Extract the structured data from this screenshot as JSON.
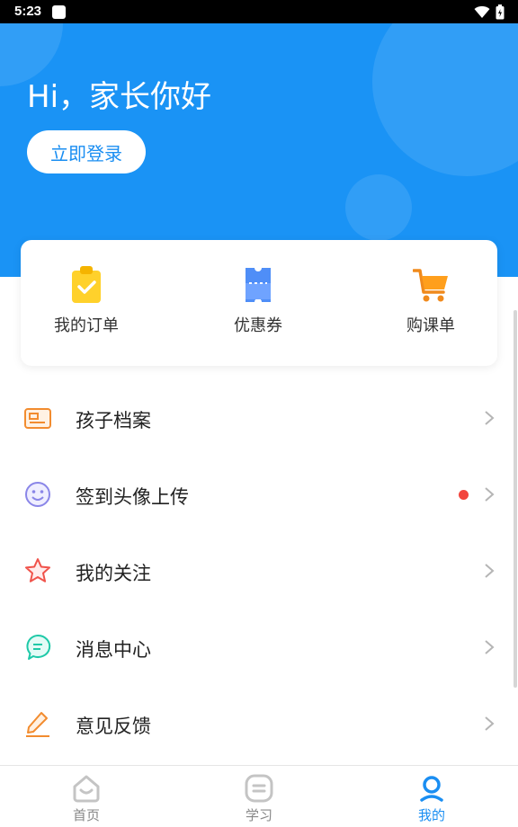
{
  "status_bar": {
    "time": "5:23"
  },
  "hero": {
    "greeting": "Hi，家长你好",
    "login_label": "立即登录",
    "background_color": "#1a93f5"
  },
  "quick_actions": [
    {
      "label": "我的订单",
      "icon": "clipboard-check-icon"
    },
    {
      "label": "优惠券",
      "icon": "ticket-icon"
    },
    {
      "label": "购课单",
      "icon": "cart-icon"
    }
  ],
  "menu": [
    {
      "label": "孩子档案",
      "icon": "id-card-icon"
    },
    {
      "label": "签到头像上传",
      "icon": "smiley-icon",
      "badge": "red-dot"
    },
    {
      "label": "我的关注",
      "icon": "star-icon"
    },
    {
      "label": "消息中心",
      "icon": "message-icon"
    },
    {
      "label": "意见反馈",
      "icon": "edit-icon"
    }
  ],
  "bottom_nav": {
    "active": "我的",
    "accent_color": "#1a8ef2",
    "tabs": [
      {
        "label": "首页",
        "icon": "home-icon"
      },
      {
        "label": "学习",
        "icon": "study-icon"
      },
      {
        "label": "我的",
        "icon": "profile-icon"
      }
    ]
  }
}
